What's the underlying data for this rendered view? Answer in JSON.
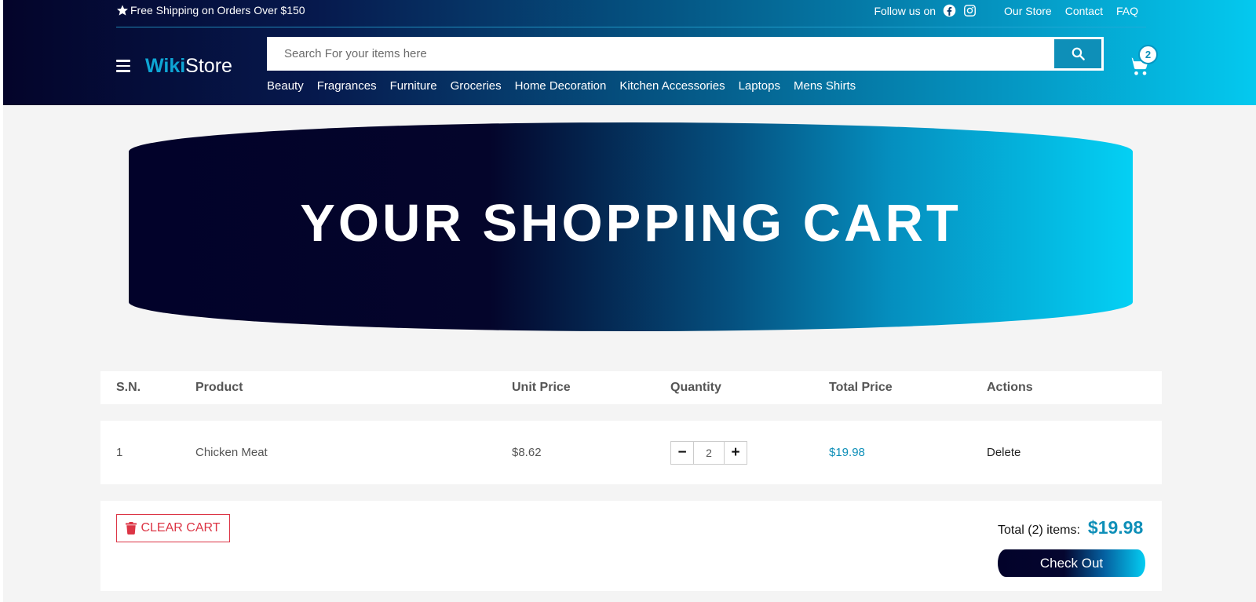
{
  "topbar": {
    "promo": "Free Shipping on Orders Over $150",
    "follow_label": "Follow us on",
    "links": [
      "Our Store",
      "Contact",
      "FAQ"
    ]
  },
  "brand": {
    "part1": "Wiki",
    "part2": "Store"
  },
  "search": {
    "placeholder": "Search For your items here",
    "value": ""
  },
  "categories": [
    "Beauty",
    "Fragrances",
    "Furniture",
    "Groceries",
    "Home Decoration",
    "Kitchen Accessories",
    "Laptops",
    "Mens Shirts"
  ],
  "cart": {
    "count": "2"
  },
  "hero": {
    "title": "YOUR SHOPPING CART"
  },
  "table": {
    "headers": [
      "S.N.",
      "Product",
      "Unit Price",
      "Quantity",
      "Total Price",
      "Actions"
    ],
    "rows": [
      {
        "sn": "1",
        "product": "Chicken Meat",
        "unit_price": "$8.62",
        "quantity": "2",
        "total_price": "$19.98",
        "action": "Delete"
      }
    ]
  },
  "summary": {
    "clear_label": "CLEAR CART",
    "total_label": "Total (2) items:",
    "total_amount": "$19.98",
    "checkout_label": "Check Out"
  },
  "colors": {
    "accent": "#0e8fb8",
    "danger": "#dc3545",
    "navy": "#04042a",
    "cyan": "#04c9ef"
  }
}
